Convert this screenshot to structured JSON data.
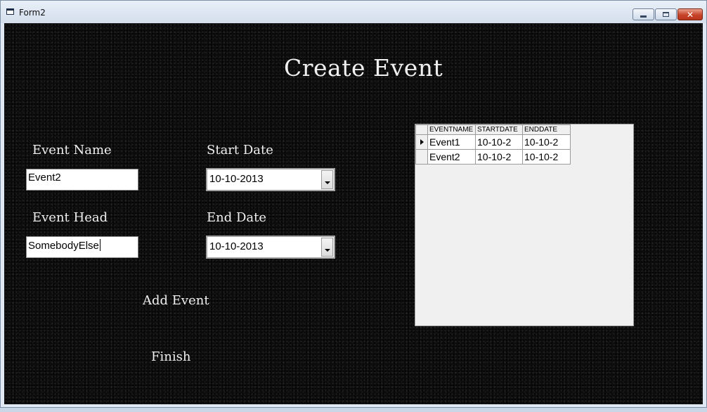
{
  "window": {
    "title": "Form2",
    "icon": "form-icon"
  },
  "form": {
    "heading": "Create Event",
    "event_name": {
      "label": "Event Name",
      "value": "Event2"
    },
    "event_head": {
      "label": "Event Head",
      "value": "SomebodyElse"
    },
    "start_date": {
      "label": "Start Date",
      "value": "10-10-2013"
    },
    "end_date": {
      "label": "End Date",
      "value": "10-10-2013"
    },
    "add_event_label": "Add Event",
    "finish_label": "Finish"
  },
  "grid": {
    "columns": [
      "EVENTNAME",
      "STARTDATE",
      "ENDDATE"
    ],
    "rows": [
      {
        "cells": [
          "Event1",
          "10-10-2",
          "10-10-2"
        ],
        "selected": true
      },
      {
        "cells": [
          "Event2",
          "10-10-2",
          "10-10-2"
        ],
        "selected": false
      }
    ]
  },
  "colors": {
    "background": "#0d0d0d",
    "text": "#f0f0f0",
    "grid_bg": "#f0f0f0"
  }
}
